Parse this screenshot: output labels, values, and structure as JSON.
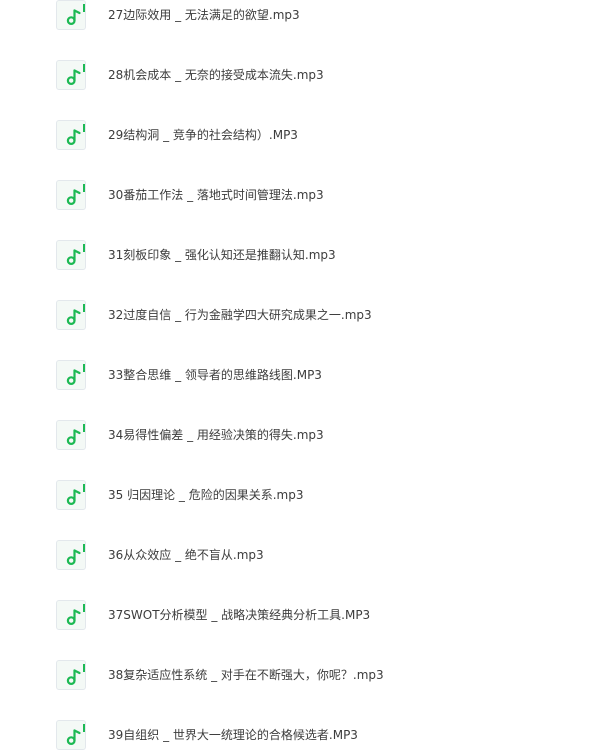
{
  "files": [
    {
      "name": "27边际效用 _ 无法满足的欲望.mp3",
      "icon": "music-note-icon"
    },
    {
      "name": "28机会成本 _ 无奈的接受成本流失.mp3",
      "icon": "music-note-icon"
    },
    {
      "name": "29结构洞 _ 竞争的社会结构）.MP3",
      "icon": "music-note-icon"
    },
    {
      "name": "30番茄工作法 _ 落地式时间管理法.mp3",
      "icon": "music-note-icon"
    },
    {
      "name": "31刻板印象 _ 强化认知还是推翻认知.mp3",
      "icon": "music-note-icon"
    },
    {
      "name": "32过度自信 _ 行为金融学四大研究成果之一.mp3",
      "icon": "music-note-icon"
    },
    {
      "name": "33整合思维 _ 领导者的思维路线图.MP3",
      "icon": "music-note-icon"
    },
    {
      "name": "34易得性偏差 _ 用经验决策的得失.mp3",
      "icon": "music-note-icon"
    },
    {
      "name": "35 归因理论 _ 危险的因果关系.mp3",
      "icon": "music-note-icon"
    },
    {
      "name": "36从众效应 _ 绝不盲从.mp3",
      "icon": "music-note-icon"
    },
    {
      "name": "37SWOT分析模型 _ 战略决策经典分析工具.MP3",
      "icon": "music-note-icon"
    },
    {
      "name": "38复杂适应性系统 _ 对手在不断强大，你呢？.mp3",
      "icon": "music-note-icon"
    },
    {
      "name": "39自组织 _ 世界大一统理论的合格候选者.MP3",
      "icon": "music-note-icon"
    }
  ],
  "colors": {
    "icon_green": "#1db954",
    "icon_bg": "#f4f9f6",
    "text": "#3c3c3c"
  }
}
